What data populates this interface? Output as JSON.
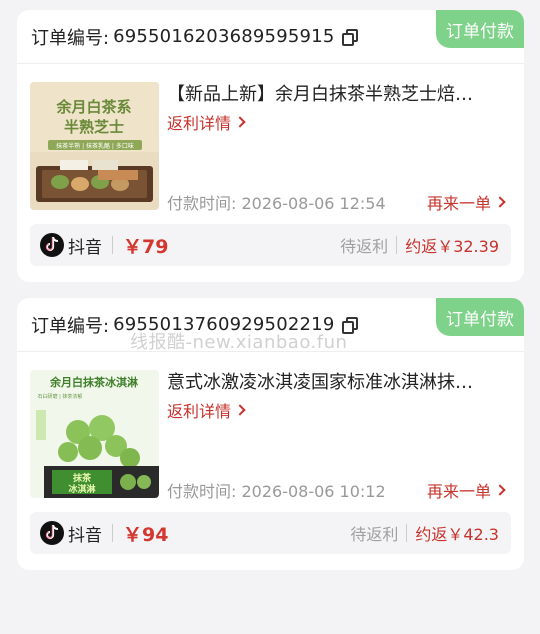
{
  "watermark": "线报酷-new.xianbao.fun",
  "colors": {
    "accent_red": "#c8322c",
    "badge_green": "#7fd28a",
    "bg": "#f3f3f5"
  },
  "orders": [
    {
      "order_label": "订单编号:",
      "order_no": "6955016203689595915",
      "status": "订单付款",
      "title": "【新品上新】余月白抹茶半熟芝士焙…",
      "rebate_detail": "返利详情",
      "pay_time": "付款时间: 2026-08-06 12:54",
      "reorder": "再来一单",
      "platform": "抖音",
      "price": "￥79",
      "pending": "待返利",
      "rebate": "约返￥32.39",
      "image": {
        "line1": "余月白茶系",
        "line2": "半熟芝士",
        "sub": "抹茶半熟 | 抹茶乳酪 | 多口味"
      }
    },
    {
      "order_label": "订单编号:",
      "order_no": "6955013760929502219",
      "status": "订单付款",
      "title": "意式冰激凌冰淇凌国家标准冰淇淋抹…",
      "rebate_detail": "返利详情",
      "pay_time": "付款时间: 2026-08-06 10:12",
      "reorder": "再来一单",
      "platform": "抖音",
      "price": "￥94",
      "pending": "待返利",
      "rebate": "约返￥42.3",
      "image": {
        "line1": "余月白抹茶冰淇淋",
        "sub": "石臼研磨 | 抹茶浓郁",
        "box1": "抹茶",
        "box2": "冰淇淋"
      }
    }
  ]
}
